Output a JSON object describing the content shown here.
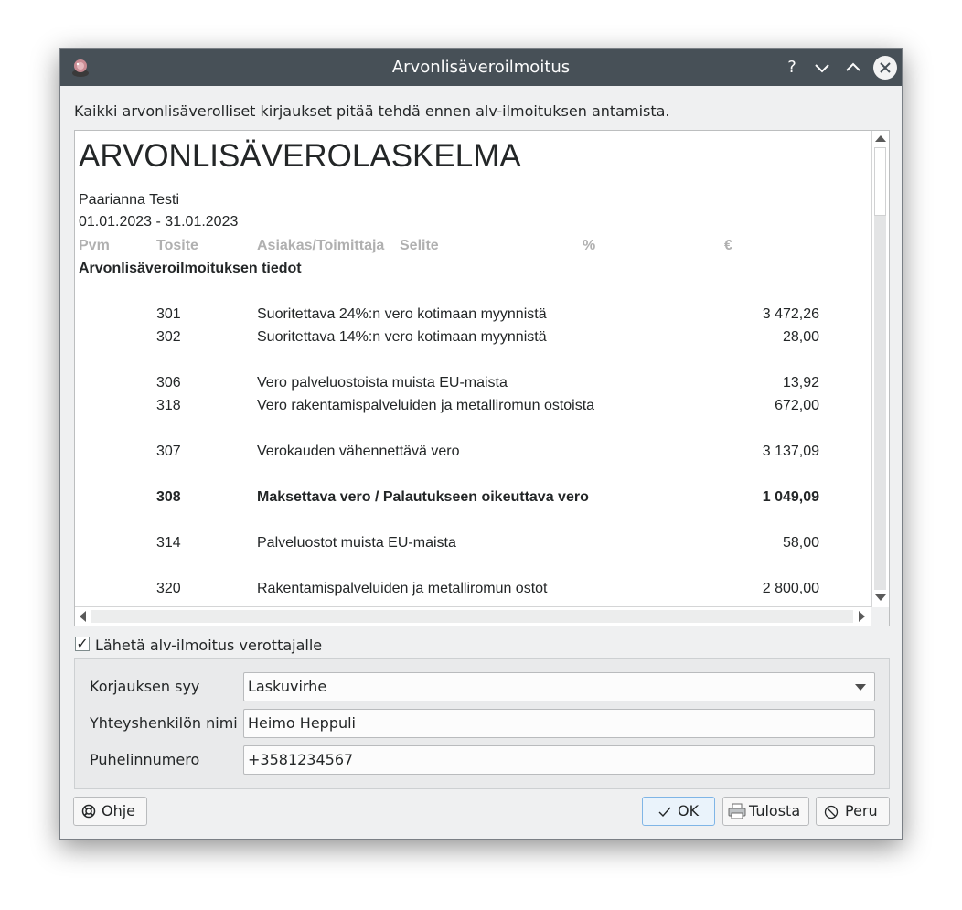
{
  "window": {
    "title": "Arvonlisäveroilmoitus",
    "help_glyph": "?",
    "minimize_glyph": "∨",
    "maximize_glyph": "∧"
  },
  "intro_text": "Kaikki arvonlisäverolliset kirjaukset pitää tehdä ennen alv-ilmoituksen antamista.",
  "report": {
    "heading": "ARVONLISÄVEROLASKELMA",
    "company": "Paarianna Testi",
    "period": "01.01.2023 - 31.01.2023",
    "columns": [
      "Pvm",
      "Tosite",
      "Asiakas/Toimittaja",
      "Selite",
      "%",
      "€"
    ],
    "section_title": "Arvonlisäveroilmoituksen tiedot",
    "rows": [
      {
        "code": "301",
        "description": "Suoritettava 24%:n vero kotimaan myynnistä",
        "amount": "3 472,26"
      },
      {
        "code": "302",
        "description": "Suoritettava 14%:n vero kotimaan myynnistä",
        "amount": "28,00"
      },
      {
        "code": "306",
        "description": "Vero palveluostoista muista EU-maista",
        "amount": "13,92"
      },
      {
        "code": "318",
        "description": "Vero rakentamispalveluiden ja metalliromun ostoista",
        "amount": "672,00"
      },
      {
        "code": "307",
        "description": "Verokauden vähennettävä vero",
        "amount": "3 137,09"
      },
      {
        "code": "308",
        "description": "Maksettava vero / Palautukseen oikeuttava vero",
        "amount": "1 049,09"
      },
      {
        "code": "314",
        "description": "Palveluostot muista EU-maista",
        "amount": "58,00"
      },
      {
        "code": "320",
        "description": "Rakentamispalveluiden ja metalliromun ostot",
        "amount": "2 800,00"
      }
    ]
  },
  "send_checkbox": {
    "label": "Lähetä alv-ilmoitus verottajalle",
    "checked": true,
    "glyph": "✓"
  },
  "form": {
    "reason_label": "Korjauksen syy",
    "reason_value": "Laskuvirhe",
    "contact_label": "Yhteyshenkilön nimi",
    "contact_value": "Heimo Heppuli",
    "phone_label": "Puhelinnumero",
    "phone_value": "+3581234567"
  },
  "buttons": {
    "help": "Ohje",
    "ok": "OK",
    "print": "Tulosta",
    "cancel": "Peru"
  },
  "colors": {
    "titlebar": "#475057",
    "accent": "#3daee9"
  }
}
